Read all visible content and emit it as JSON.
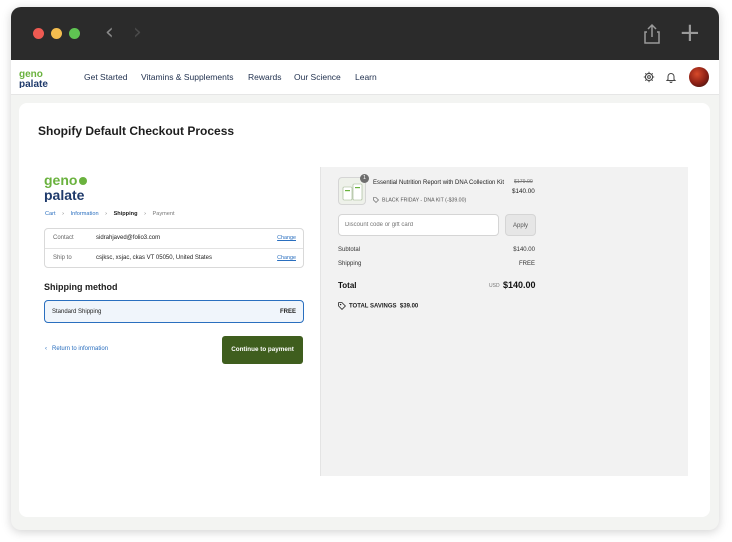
{
  "nav": {
    "links": [
      "Get Started",
      "Vitamins & Supplements",
      "Rewards",
      "Our Science",
      "Learn"
    ]
  },
  "page": {
    "title": "Shopify Default Checkout Process"
  },
  "breadcrumb": {
    "cart": "Cart",
    "information": "Information",
    "shipping": "Shipping",
    "payment": "Payment"
  },
  "contact": {
    "label": "Contact",
    "value": "sidrahjaved@folio3.com",
    "change": "Change"
  },
  "ship_to": {
    "label": "Ship to",
    "value": "csjksc, xsjac, ckas VT 05050, United States",
    "change": "Change"
  },
  "shipping_method": {
    "heading": "Shipping method",
    "option": "Standard Shipping",
    "price": "FREE"
  },
  "actions": {
    "return": "Return to information",
    "continue": "Continue to payment"
  },
  "order": {
    "quantity": "1",
    "product_name": "Essential Nutrition Report with DNA Collection Kit",
    "discount_label": "BLACK FRIDAY - DNA KIT (-$39.00)",
    "original_price": "$179.00",
    "price": "$140.00",
    "discount_placeholder": "Discount code or gift card",
    "apply": "Apply",
    "subtotal_label": "Subtotal",
    "subtotal": "$140.00",
    "shipping_label": "Shipping",
    "shipping": "FREE",
    "total_label": "Total",
    "currency": "USD",
    "total": "$140.00",
    "savings": "TOTAL SAVINGS  $39.00"
  },
  "colors": {
    "brand_green": "#3f5e1e",
    "link_blue": "#2a6fbf",
    "logo_green": "#6ab23e",
    "logo_navy": "#1f3a6b"
  },
  "icons": [
    "back-arrow-icon",
    "forward-arrow-icon",
    "share-icon",
    "plus-icon",
    "settings-icon",
    "bell-icon",
    "chevron-left-icon",
    "tag-icon"
  ]
}
